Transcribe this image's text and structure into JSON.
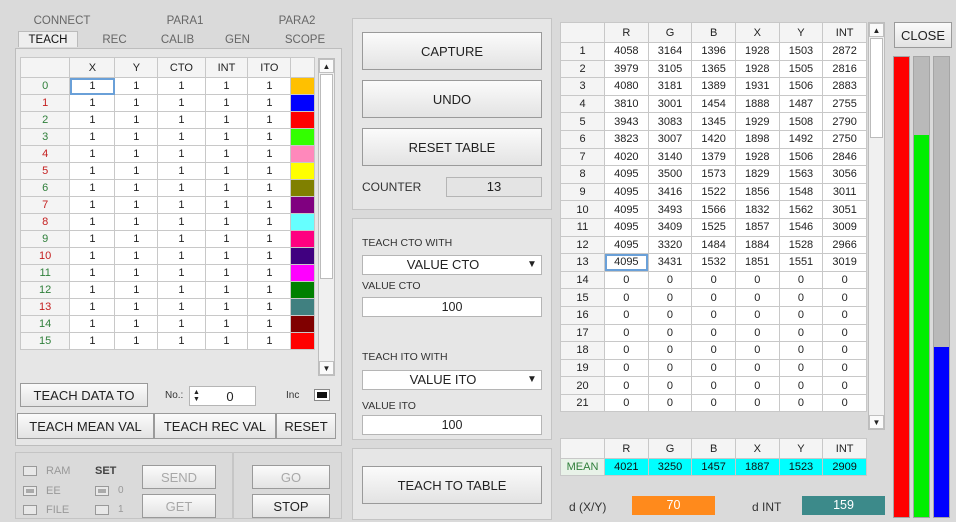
{
  "tabs_top": [
    "CONNECT",
    "PARA1",
    "PARA2"
  ],
  "tabs_bottom": [
    "TEACH",
    "REC",
    "CALIB",
    "GEN",
    "SCOPE"
  ],
  "teach_table": {
    "headers": [
      "X",
      "Y",
      "CTO",
      "INT",
      "ITO"
    ],
    "rows": [
      {
        "n": "0",
        "v": [
          "1",
          "1",
          "1",
          "1",
          "1"
        ],
        "c": "#ffc000"
      },
      {
        "n": "1",
        "v": [
          "1",
          "1",
          "1",
          "1",
          "1"
        ],
        "c": "#0000ff"
      },
      {
        "n": "2",
        "v": [
          "1",
          "1",
          "1",
          "1",
          "1"
        ],
        "c": "#ff0000"
      },
      {
        "n": "3",
        "v": [
          "1",
          "1",
          "1",
          "1",
          "1"
        ],
        "c": "#33ff00"
      },
      {
        "n": "4",
        "v": [
          "1",
          "1",
          "1",
          "1",
          "1"
        ],
        "c": "#ff88bb"
      },
      {
        "n": "5",
        "v": [
          "1",
          "1",
          "1",
          "1",
          "1"
        ],
        "c": "#ffff00"
      },
      {
        "n": "6",
        "v": [
          "1",
          "1",
          "1",
          "1",
          "1"
        ],
        "c": "#808000"
      },
      {
        "n": "7",
        "v": [
          "1",
          "1",
          "1",
          "1",
          "1"
        ],
        "c": "#800080"
      },
      {
        "n": "8",
        "v": [
          "1",
          "1",
          "1",
          "1",
          "1"
        ],
        "c": "#66ffff"
      },
      {
        "n": "9",
        "v": [
          "1",
          "1",
          "1",
          "1",
          "1"
        ],
        "c": "#ff0080"
      },
      {
        "n": "10",
        "v": [
          "1",
          "1",
          "1",
          "1",
          "1"
        ],
        "c": "#400080"
      },
      {
        "n": "11",
        "v": [
          "1",
          "1",
          "1",
          "1",
          "1"
        ],
        "c": "#ff00ff"
      },
      {
        "n": "12",
        "v": [
          "1",
          "1",
          "1",
          "1",
          "1"
        ],
        "c": "#008000"
      },
      {
        "n": "13",
        "v": [
          "1",
          "1",
          "1",
          "1",
          "1"
        ],
        "c": "#408080"
      },
      {
        "n": "14",
        "v": [
          "1",
          "1",
          "1",
          "1",
          "1"
        ],
        "c": "#800000"
      },
      {
        "n": "15",
        "v": [
          "1",
          "1",
          "1",
          "1",
          "1"
        ],
        "c": "#ff0000"
      }
    ]
  },
  "teach_data_to": "TEACH DATA TO",
  "no_label": "No.:",
  "no_value": "0",
  "inc_label": "Inc",
  "teach_mean_val": "TEACH MEAN VAL",
  "teach_rec_val": "TEACH REC VAL",
  "reset": "RESET",
  "io": {
    "ram": "RAM",
    "ee": "EE",
    "file": "FILE",
    "set": "SET",
    "zero": "0",
    "one": "1",
    "send": "SEND",
    "get": "GET",
    "go": "GO",
    "stop": "STOP"
  },
  "capture": "CAPTURE",
  "undo": "UNDO",
  "reset_table": "RESET TABLE",
  "counter_label": "COUNTER",
  "counter_value": "13",
  "teach_cto_with": "TEACH CTO WITH",
  "cto_select": "VALUE CTO",
  "value_cto_label": "VALUE CTO",
  "value_cto": "100",
  "teach_ito_with": "TEACH ITO WITH",
  "ito_select": "VALUE ITO",
  "value_ito_label": "VALUE ITO",
  "value_ito": "100",
  "teach_to_table": "TEACH TO TABLE",
  "rec_table": {
    "headers": [
      "R",
      "G",
      "B",
      "X",
      "Y",
      "INT"
    ],
    "rows": [
      [
        "1",
        "4058",
        "3164",
        "1396",
        "1928",
        "1503",
        "2872"
      ],
      [
        "2",
        "3979",
        "3105",
        "1365",
        "1928",
        "1505",
        "2816"
      ],
      [
        "3",
        "4080",
        "3181",
        "1389",
        "1931",
        "1506",
        "2883"
      ],
      [
        "4",
        "3810",
        "3001",
        "1454",
        "1888",
        "1487",
        "2755"
      ],
      [
        "5",
        "3943",
        "3083",
        "1345",
        "1929",
        "1508",
        "2790"
      ],
      [
        "6",
        "3823",
        "3007",
        "1420",
        "1898",
        "1492",
        "2750"
      ],
      [
        "7",
        "4020",
        "3140",
        "1379",
        "1928",
        "1506",
        "2846"
      ],
      [
        "8",
        "4095",
        "3500",
        "1573",
        "1829",
        "1563",
        "3056"
      ],
      [
        "9",
        "4095",
        "3416",
        "1522",
        "1856",
        "1548",
        "3011"
      ],
      [
        "10",
        "4095",
        "3493",
        "1566",
        "1832",
        "1562",
        "3051"
      ],
      [
        "11",
        "4095",
        "3409",
        "1525",
        "1857",
        "1546",
        "3009"
      ],
      [
        "12",
        "4095",
        "3320",
        "1484",
        "1884",
        "1528",
        "2966"
      ],
      [
        "13",
        "4095",
        "3431",
        "1532",
        "1851",
        "1551",
        "3019"
      ],
      [
        "14",
        "0",
        "0",
        "0",
        "0",
        "0",
        "0"
      ],
      [
        "15",
        "0",
        "0",
        "0",
        "0",
        "0",
        "0"
      ],
      [
        "16",
        "0",
        "0",
        "0",
        "0",
        "0",
        "0"
      ],
      [
        "17",
        "0",
        "0",
        "0",
        "0",
        "0",
        "0"
      ],
      [
        "18",
        "0",
        "0",
        "0",
        "0",
        "0",
        "0"
      ],
      [
        "19",
        "0",
        "0",
        "0",
        "0",
        "0",
        "0"
      ],
      [
        "20",
        "0",
        "0",
        "0",
        "0",
        "0",
        "0"
      ],
      [
        "21",
        "0",
        "0",
        "0",
        "0",
        "0",
        "0"
      ]
    ]
  },
  "mean": {
    "label": "MEAN",
    "values": [
      "4021",
      "3250",
      "1457",
      "1887",
      "1523",
      "2909"
    ]
  },
  "dxy_label": "d (X/Y)",
  "dxy_value": "70",
  "dint_label": "d INT",
  "dint_value": "159",
  "close": "CLOSE",
  "bars": {
    "red": 1.0,
    "green": 0.83,
    "blue": 0.37
  }
}
